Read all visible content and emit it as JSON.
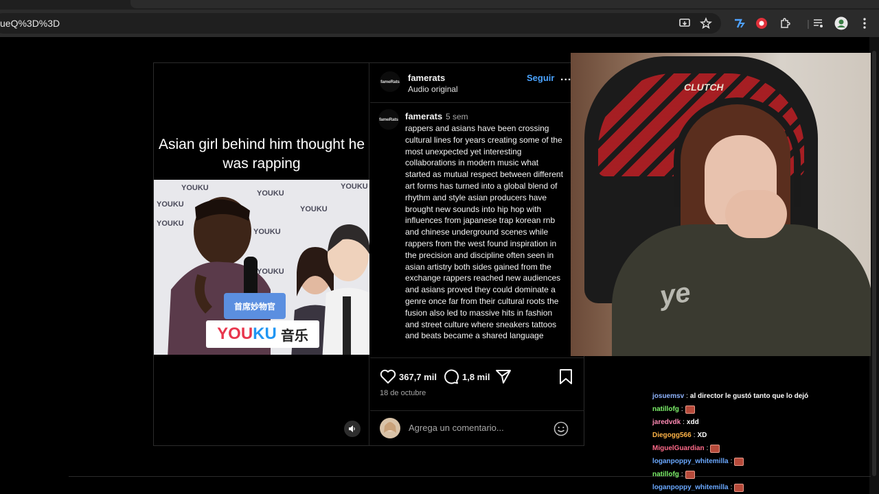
{
  "browser": {
    "url": "ueQ%3D%3D",
    "icons": [
      "install-icon",
      "star-icon",
      "extension-translate-icon",
      "extension-record-icon",
      "puzzle-icon",
      "media-icon",
      "profile-avatar",
      "menu-icon"
    ]
  },
  "post": {
    "video_caption": "Asian girl behind him thought he was rapping",
    "video_logos": [
      "YOUKU",
      "YOUKU",
      "YOUKU",
      "YOUKU",
      "YOUKU",
      "YOUKU",
      "YOUKU",
      "YOUKU"
    ],
    "banner_brand_a": "YOU",
    "banner_brand_b": "KU",
    "banner_brand_c": "音乐",
    "mic_flag_text": "首席妙物官",
    "author": {
      "avatar_text": "fameRats",
      "username": "famerats",
      "audio": "Audio original",
      "follow": "Seguir",
      "more": "..."
    },
    "caption_block": {
      "avatar_text": "fameRats",
      "username": "famerats",
      "time": "5 sem",
      "text": "rappers and asians have been crossing cultural lines for years creating some of the most unexpected yet interesting collaborations in modern music what started as mutual respect between different art forms has turned into a global blend of rhythm and style asian producers have brought new sounds into hip hop with influences from japanese trap korean rnb and chinese underground scenes while rappers from the west found inspiration in the precision and discipline often seen in asian artistry both sides gained from the exchange rappers reached new audiences and asians proved they could dominate a genre once far from their cultural roots the fusion also led to massive hits in fashion and street culture where sneakers tattoos and beats became a shared language"
    },
    "likes": "367,7 mil",
    "comments": "1,8 mil",
    "date": "18 de octubre",
    "comment_placeholder": "Agrega un comentario..."
  },
  "webcam": {
    "chair_logo": "CLUTCH",
    "hoodie_text": "ye"
  },
  "chat": [
    {
      "user": "josuemsv",
      "color": "#8fb4ff",
      "msg": "al director le gustó tanto que lo dejó",
      "emote": false
    },
    {
      "user": "natillofg",
      "color": "#7cf06a",
      "msg": "",
      "emote": true
    },
    {
      "user": "jaredvdk",
      "color": "#ff8ab4",
      "msg": "xdd",
      "emote": false
    },
    {
      "user": "Diegogg566",
      "color": "#ffb347",
      "msg": "XD",
      "emote": false
    },
    {
      "user": "MiguelGuardian",
      "color": "#ff6b8a",
      "msg": "",
      "emote": true
    },
    {
      "user": "loganpoppy_whitemilla",
      "color": "#6aa8ff",
      "msg": "",
      "emote": true
    },
    {
      "user": "natillofg",
      "color": "#7cf06a",
      "msg": "",
      "emote": true
    },
    {
      "user": "loganpoppy_whitemilla",
      "color": "#6aa8ff",
      "msg": "",
      "emote": true
    }
  ]
}
